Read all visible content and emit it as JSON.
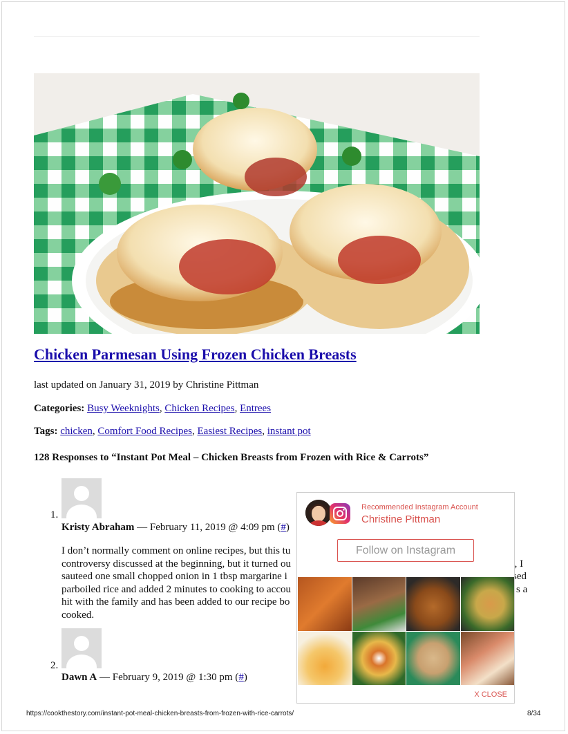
{
  "post": {
    "title": "Chicken Parmesan Using Frozen Chicken Breasts",
    "updated": "last updated on January 31, 2019 by Christine Pittman",
    "categories_label": "Categories:",
    "categories": [
      "Busy Weeknights",
      "Chicken Recipes",
      "Entrees"
    ],
    "tags_label": "Tags:",
    "tags": [
      "chicken",
      "Comfort Food Recipes",
      "Easiest Recipes",
      "instant pot"
    ],
    "separator": ","
  },
  "responses": {
    "heading": "128 Responses to “Instant Pot Meal – Chicken Breasts from Frozen with Rice & Carrots”"
  },
  "comments": [
    {
      "number": "1.",
      "author": "Kristy Abraham",
      "date": " — February 11, 2019 @ 4:09 pm (",
      "link": "#",
      "close_paren": ")",
      "body_lines": [
        "I don’t normally comment on online recipes, but this tu",
        "controversy discussed at the beginning, but it turned ou",
        "sauteed one small chopped onion in 1 tbsp margarine i",
        "parboiled rice and added 2 minutes to cooking to accou",
        "hit with the family and has been added to our recipe bo",
        "cooked."
      ],
      "body_tail_lines": [
        "",
        "ut, I",
        "sed",
        "s a",
        "",
        ""
      ]
    },
    {
      "number": "2.",
      "author": "Dawn A",
      "date": " — February 9, 2019 @ 1:30 pm (",
      "link": "#",
      "close_paren": ")"
    }
  ],
  "popup": {
    "recommended_label": "Recommended Instagram Account",
    "account_name": "Christine Pittman",
    "follow_label": "Follow on Instagram",
    "close_label": "X CLOSE",
    "thumb_icons": [
      "sweet-potato-photo",
      "ribs-photo",
      "roast-chicken-photo",
      "dip-photo",
      "cheese-sauce-photo",
      "pasta-photo",
      "casserole-photo",
      "sliders-photo"
    ]
  },
  "footer": {
    "url": "https://cookthestory.com/instant-pot-meal-chicken-breasts-from-frozen-with-rice-carrots/",
    "page": "8/34"
  },
  "colors": {
    "link": "#1a0dab",
    "accent": "#d9534f"
  }
}
